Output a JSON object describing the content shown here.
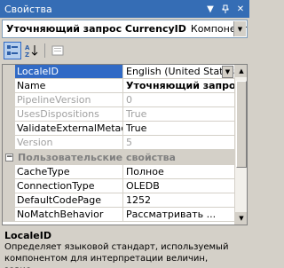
{
  "window": {
    "title": "Свойства"
  },
  "object_selector": {
    "name": "Уточняющий запрос CurrencyID",
    "type": "Компонент по"
  },
  "grid": {
    "rows": [
      {
        "name": "LocaleID",
        "value": "English (United States)"
      },
      {
        "name": "Name",
        "value": "Уточняющий запрос C"
      },
      {
        "name": "PipelineVersion",
        "value": "0"
      },
      {
        "name": "UsesDispositions",
        "value": "True"
      },
      {
        "name": "ValidateExternalMetadata",
        "value": "True"
      },
      {
        "name": "Version",
        "value": "5"
      }
    ],
    "category": "Пользовательские свойства",
    "custom_rows": [
      {
        "name": "CacheType",
        "value": "Полное"
      },
      {
        "name": "ConnectionType",
        "value": "OLEDB"
      },
      {
        "name": "DefaultCodePage",
        "value": "1252"
      },
      {
        "name": "NoMatchBehavior",
        "value": "Рассматривать ..."
      }
    ]
  },
  "description": {
    "title": "LocaleID",
    "text": "Определяет языковой стандарт, используемый компонентом для интерпретации величин, завис..."
  }
}
